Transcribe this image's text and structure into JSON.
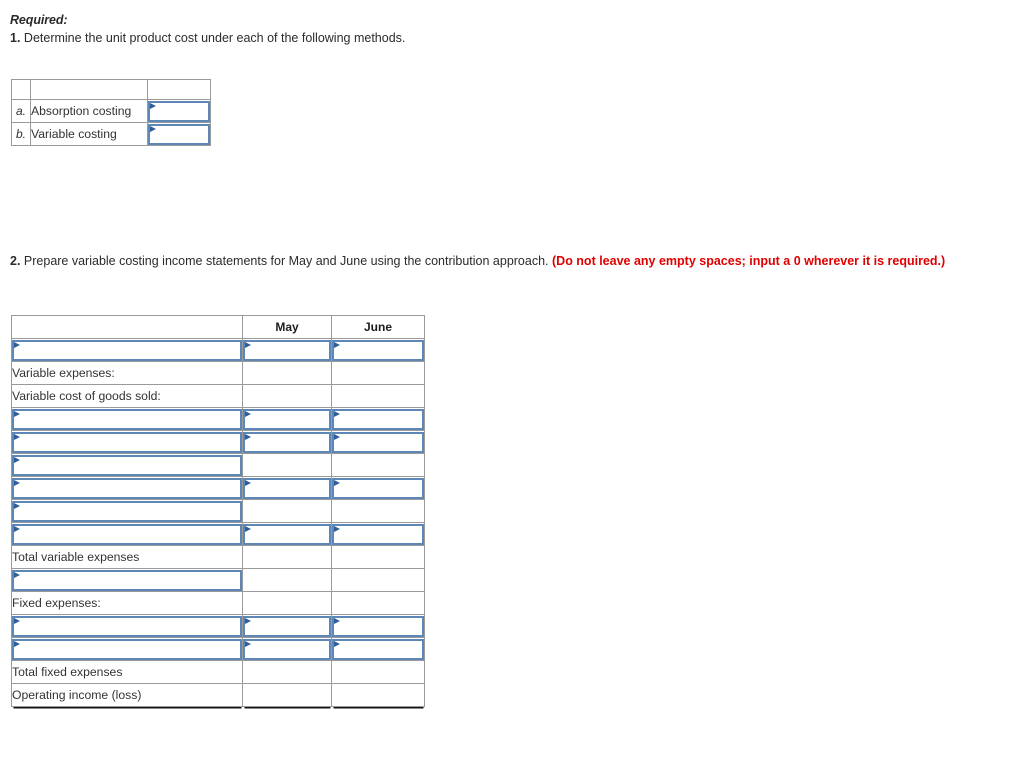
{
  "question_1": {
    "required_label": "Required:",
    "number": "1.",
    "text": " Determine the unit product cost under each of the following methods."
  },
  "question_2": {
    "number": "2.",
    "text": " Prepare variable costing income statements for May and June using the contribution approach. ",
    "warning": "(Do not leave any empty spaces; input a 0 wherever it is required.)"
  },
  "unit_cost_table": {
    "header": {
      "index": "",
      "method": "",
      "value": ""
    },
    "rows": [
      {
        "index": "a.",
        "label": "Absorption costing",
        "value": "",
        "input": true
      },
      {
        "index": "b.",
        "label": "Variable costing",
        "value": "",
        "input": true
      }
    ]
  },
  "income_table": {
    "header": {
      "account": "",
      "may": "May",
      "june": "June"
    },
    "rows": [
      {
        "label": "",
        "label_input": true,
        "may": "",
        "may_input": true,
        "june": "",
        "june_input": true,
        "rule": "none"
      },
      {
        "label": "Variable expenses:",
        "label_input": false,
        "may": "",
        "may_input": false,
        "june": "",
        "june_input": false,
        "rule": "top"
      },
      {
        "label": "Variable cost of goods sold:",
        "label_input": false,
        "may": "",
        "may_input": false,
        "june": "",
        "june_input": false,
        "rule": "none"
      },
      {
        "label": "",
        "label_input": true,
        "may": "",
        "may_input": true,
        "june": "",
        "june_input": true,
        "rule": "none"
      },
      {
        "label": "",
        "label_input": true,
        "may": "",
        "may_input": true,
        "june": "",
        "june_input": true,
        "rule": "none"
      },
      {
        "label": "",
        "label_input": true,
        "may": "",
        "may_input": false,
        "june": "",
        "june_input": false,
        "rule": "top"
      },
      {
        "label": "",
        "label_input": true,
        "may": "",
        "may_input": true,
        "june": "",
        "june_input": true,
        "rule": "none"
      },
      {
        "label": "",
        "label_input": true,
        "may": "",
        "may_input": false,
        "june": "",
        "june_input": false,
        "rule": "top"
      },
      {
        "label": "",
        "label_input": true,
        "may": "",
        "may_input": true,
        "june": "",
        "june_input": true,
        "rule": "none"
      },
      {
        "label": "Total variable expenses",
        "label_input": false,
        "may": "",
        "may_input": false,
        "june": "",
        "june_input": false,
        "rule": "top"
      },
      {
        "label": "",
        "label_input": true,
        "may": "",
        "may_input": false,
        "june": "",
        "june_input": false,
        "rule": "none"
      },
      {
        "label": "Fixed expenses:",
        "label_input": false,
        "may": "",
        "may_input": false,
        "june": "",
        "june_input": false,
        "rule": "top"
      },
      {
        "label": "",
        "label_input": true,
        "may": "",
        "may_input": true,
        "june": "",
        "june_input": true,
        "rule": "none"
      },
      {
        "label": "",
        "label_input": true,
        "may": "",
        "may_input": true,
        "june": "",
        "june_input": true,
        "rule": "none"
      },
      {
        "label": "Total fixed expenses",
        "label_input": false,
        "may": "",
        "may_input": false,
        "june": "",
        "june_input": false,
        "rule": "top"
      },
      {
        "label": "Operating income (loss)",
        "label_input": false,
        "may": "",
        "may_input": false,
        "june": "",
        "june_input": false,
        "rule": "double"
      }
    ]
  },
  "colors": {
    "header_blue": "#7cabdd",
    "input_border": "#5c87b6",
    "marker_blue": "#2f5f98",
    "warning_red": "#e00000",
    "grid_line": "#9a9a9a",
    "rule_line": "#111111"
  }
}
